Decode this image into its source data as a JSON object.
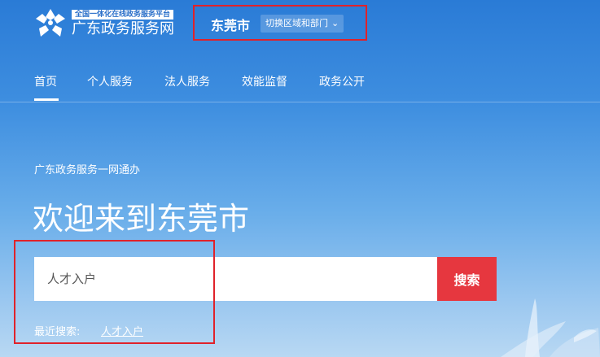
{
  "header": {
    "brand_tagline": "全国一体化在线政务服务平台",
    "brand_name": "广东政务服务网",
    "region_name": "东莞市",
    "region_switch_label": "切换区域和部门"
  },
  "nav": {
    "items": [
      {
        "label": "首页",
        "active": true
      },
      {
        "label": "个人服务"
      },
      {
        "label": "法人服务"
      },
      {
        "label": "效能监督"
      },
      {
        "label": "政务公开"
      }
    ]
  },
  "hero": {
    "subtitle": "广东政务服务一网通办",
    "headline": "欢迎来到东莞市"
  },
  "search": {
    "placeholder": "人才入户",
    "button_label": "搜索",
    "recent_label": "最近搜索:",
    "recent_items": [
      "人才入户"
    ]
  },
  "colors": {
    "accent_red": "#e6373f",
    "highlight_red": "#e0222a",
    "brand_blue": "#2a7bd6"
  }
}
